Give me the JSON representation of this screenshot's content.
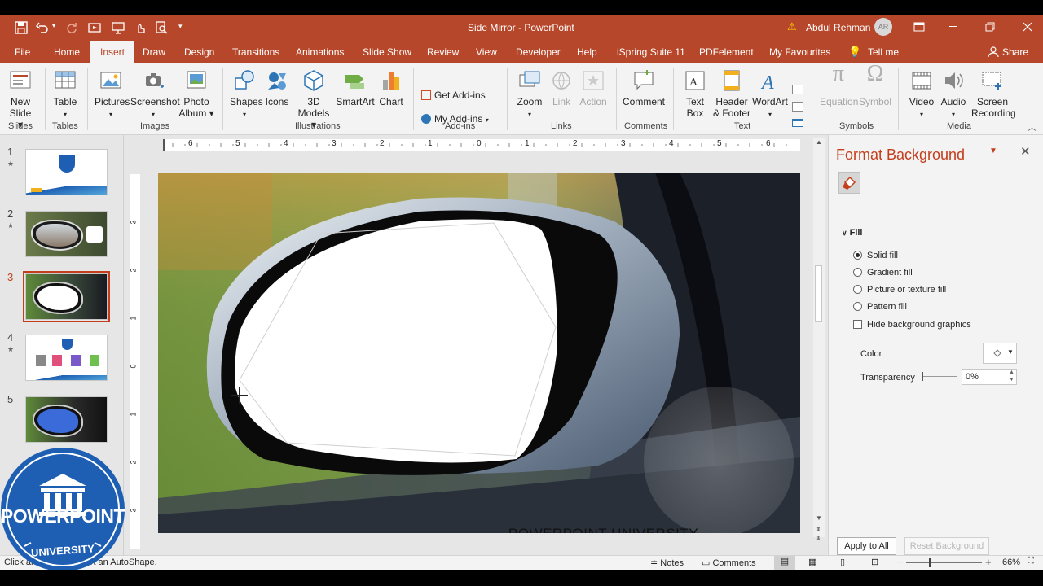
{
  "window": {
    "title": "Side Mirror  -  PowerPoint",
    "user_name": "Abdul Rehman",
    "user_initials": "AR",
    "share_label": "Share"
  },
  "tabs": [
    "File",
    "Home",
    "Insert",
    "Draw",
    "Design",
    "Transitions",
    "Animations",
    "Slide Show",
    "Review",
    "View",
    "Developer",
    "Help",
    "iSpring Suite 11",
    "PDFelement",
    "My Favourites",
    "Tell me"
  ],
  "active_tab": "Insert",
  "ribbon": {
    "new_slide": "New\nSlide",
    "table": "Table",
    "pictures": "Pictures",
    "screenshot": "Screenshot",
    "photo_album": "Photo\nAlbum",
    "shapes": "Shapes",
    "icons": "Icons",
    "models_3d": "3D\nModels",
    "smartart": "SmartArt",
    "chart": "Chart",
    "get_addins": "Get Add-ins",
    "my_addins": "My Add-ins",
    "zoom": "Zoom",
    "link": "Link",
    "action": "Action",
    "comment": "Comment",
    "text_box": "Text\nBox",
    "header_footer": "Header\n& Footer",
    "wordart": "WordArt",
    "equation": "Equation",
    "symbol": "Symbol",
    "video": "Video",
    "audio": "Audio",
    "screen_recording": "Screen\nRecording",
    "groups": {
      "slides": "Slides",
      "tables": "Tables",
      "images": "Images",
      "illustrations": "Illustrations",
      "addins": "Add-ins",
      "links": "Links",
      "comments": "Comments",
      "text": "Text",
      "symbols": "Symbols",
      "media": "Media"
    }
  },
  "ruler": {
    "h_ticks": [
      "6",
      "5",
      "4",
      "3",
      "2",
      "1",
      "0",
      "1",
      "2",
      "3",
      "4",
      "5",
      "6"
    ],
    "v_ticks": [
      "3",
      "2",
      "1",
      "0",
      "1",
      "2",
      "3"
    ]
  },
  "slides": [
    {
      "num": "1",
      "starred": true
    },
    {
      "num": "2",
      "starred": true
    },
    {
      "num": "3",
      "starred": false,
      "selected": true
    },
    {
      "num": "4",
      "starred": true
    },
    {
      "num": "5",
      "starred": false
    }
  ],
  "slide_watermark": "POWERPOINT UNIVERSITY",
  "logo": {
    "top": "POWERPOINT",
    "bottom": "UNIVERSITY"
  },
  "format_pane": {
    "title": "Format Background",
    "section": "Fill",
    "options": [
      "Solid fill",
      "Gradient fill",
      "Picture or texture fill",
      "Pattern fill"
    ],
    "selected_option": "Solid fill",
    "hide_graphics": "Hide background graphics",
    "color_label": "Color",
    "transparency_label": "Transparency",
    "transparency_value": "0%",
    "apply_all": "Apply to All",
    "reset": "Reset Background"
  },
  "status": {
    "message": "Click and drag to insert an AutoShape.",
    "notes": "Notes",
    "comments": "Comments",
    "zoom": "66%"
  },
  "colors": {
    "accent": "#b7472a",
    "selection": "#c43e1c",
    "logo_blue": "#1e5fb3"
  }
}
